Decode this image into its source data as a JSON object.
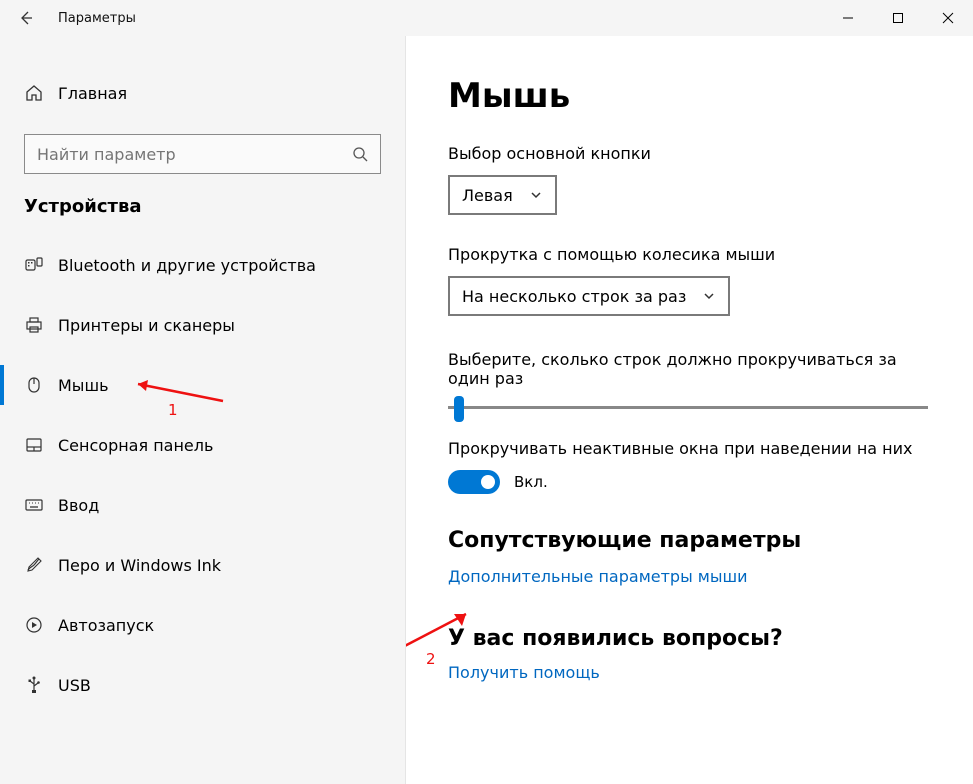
{
  "window": {
    "title": "Параметры"
  },
  "sidebar": {
    "home_label": "Главная",
    "search_placeholder": "Найти параметр",
    "section_label": "Устройства",
    "items": [
      {
        "label": "Bluetooth и другие устройства",
        "icon": "bluetooth-devices-icon"
      },
      {
        "label": "Принтеры и сканеры",
        "icon": "printer-icon"
      },
      {
        "label": "Мышь",
        "icon": "mouse-icon"
      },
      {
        "label": "Сенсорная панель",
        "icon": "touchpad-icon"
      },
      {
        "label": "Ввод",
        "icon": "keyboard-icon"
      },
      {
        "label": "Перо и Windows Ink",
        "icon": "pen-icon"
      },
      {
        "label": "Автозапуск",
        "icon": "autoplay-icon"
      },
      {
        "label": "USB",
        "icon": "usb-icon"
      }
    ],
    "selected_index": 2
  },
  "main": {
    "heading": "Мышь",
    "primary_button": {
      "label": "Выбор основной кнопки",
      "value": "Левая"
    },
    "wheel_scroll": {
      "label": "Прокрутка с помощью колесика мыши",
      "value": "На несколько строк за раз"
    },
    "lines_per_scroll": {
      "label": "Выберите, сколько строк должно прокручиваться за один раз"
    },
    "inactive_scroll": {
      "label": "Прокручивать неактивные окна при наведении на них",
      "state_label": "Вкл.",
      "on": true
    },
    "related": {
      "heading": "Сопутствующие параметры",
      "link": "Дополнительные параметры мыши"
    },
    "questions": {
      "heading": "У вас появились вопросы?",
      "link": "Получить помощь"
    }
  },
  "annotations": {
    "num1": "1",
    "num2": "2"
  },
  "colors": {
    "accent": "#0078d4",
    "link": "#0067c0",
    "annotation": "#e11"
  }
}
